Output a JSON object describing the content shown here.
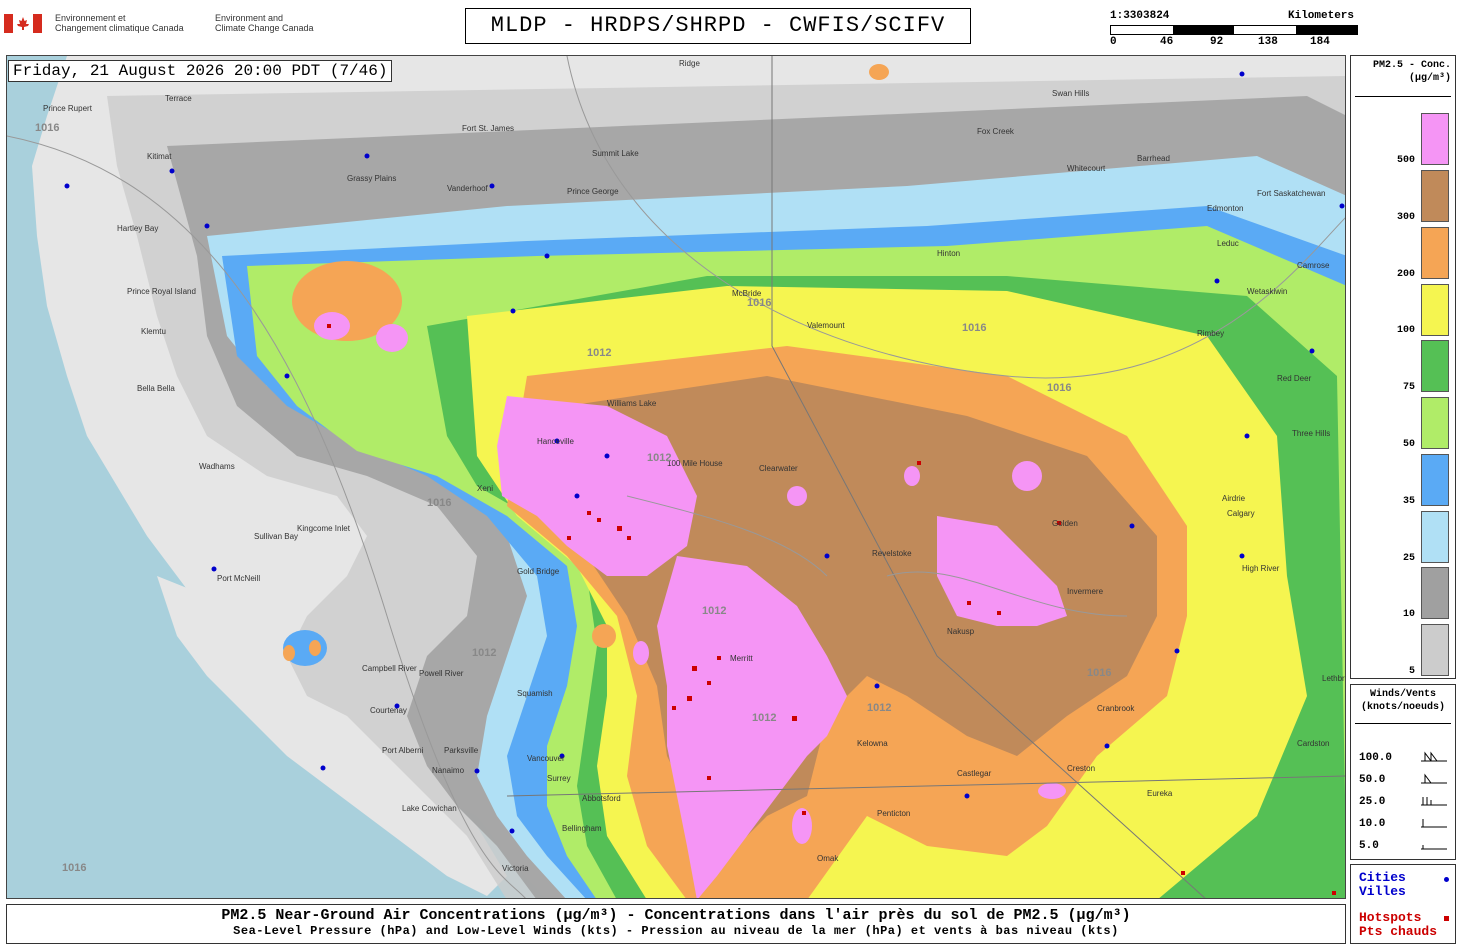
{
  "header": {
    "agency_fr": "Environnement et\nChangement climatique Canada",
    "agency_en": "Environment and\nClimate Change Canada",
    "title": "MLDP - HRDPS/SHRPD - CWFIS/SCIFV"
  },
  "scale": {
    "ratio": "1:3303824",
    "unit": "Kilometers",
    "ticks": [
      "0",
      "46",
      "92",
      "138",
      "184"
    ]
  },
  "datetime": "Friday, 21 August 2026 20:00 PDT (7/46)",
  "legend_pm": {
    "title": "PM2.5 - Conc.\n(µg/m³)",
    "levels": [
      {
        "label": "500",
        "color": "#f595f5"
      },
      {
        "label": "300",
        "color": "#c08a5a"
      },
      {
        "label": "200",
        "color": "#f5a555"
      },
      {
        "label": "100",
        "color": "#f5f550"
      },
      {
        "label": "75",
        "color": "#55c055"
      },
      {
        "label": "50",
        "color": "#b0ec68"
      },
      {
        "label": "35",
        "color": "#5aaaf5"
      },
      {
        "label": "25",
        "color": "#b0e0f5"
      },
      {
        "label": "10",
        "color": "#a0a0a0"
      },
      {
        "label": "5",
        "color": "#cccccc"
      }
    ]
  },
  "legend_wind": {
    "title": "Winds/Vents\n(knots/noeuds)",
    "levels": [
      "100.0",
      "50.0",
      "25.0",
      "10.0",
      "5.0"
    ]
  },
  "legend_points": {
    "cities": "Cities\nVilles",
    "hotspots": "Hotspots\nPts chauds",
    "city_color": "#0000cc",
    "hotspot_color": "#cc0000"
  },
  "footer": {
    "title": "PM2.5 Near-Ground Air Concentrations (µg/m³) - Concentrations dans l'air près du sol de PM2.5 (µg/m³)",
    "subtitle": "Sea-Level Pressure (hPa) and Low-Level Winds (kts) - Pression au niveau de la mer (hPa) et vents à bas niveau (kts)"
  },
  "map_labels": {
    "cities": [
      "Prince Rupert",
      "Terrace",
      "Kitimat",
      "Hartley Bay",
      "Prince Royal Island",
      "Klemtu",
      "Bella Bella",
      "Wadhams",
      "Port McNeill",
      "Sullivan Bay",
      "Kingcome Inlet",
      "Campbell River",
      "Courtenay",
      "Port Alberni",
      "Parksville",
      "Nanaimo",
      "Lake Cowichan",
      "Victoria",
      "Vancouver",
      "Surrey",
      "Bellingham",
      "Squamish",
      "Powell River",
      "Gold Bridge",
      "Xeni",
      "Hanceville",
      "Williams Lake",
      "100 Mile House",
      "Clearwater",
      "Revelstoke",
      "Golden",
      "Merritt",
      "Nakusp",
      "Cranbrook",
      "Creston",
      "Invermere",
      "Calgary",
      "High River",
      "Lethbridge",
      "Airdrie",
      "Red Deer",
      "Three Hills",
      "Edmonton",
      "Leduc",
      "Camrose",
      "Wetaskiwin",
      "Rimbey",
      "Barrhead",
      "Fort Saskatchewan",
      "Whitecourt",
      "Swan Hills",
      "Fox Creek",
      "Hinton",
      "Valemount",
      "McBride",
      "Prince George",
      "Vanderhoof",
      "Fort St. James",
      "Summit Lake",
      "Grassy Plains",
      "Kelowna",
      "Omak",
      "Eureka",
      "Cardston",
      "Ridge",
      "Abbotsford",
      "Penticton",
      "Castlegar"
    ],
    "isobars": [
      "1016",
      "1012"
    ]
  }
}
